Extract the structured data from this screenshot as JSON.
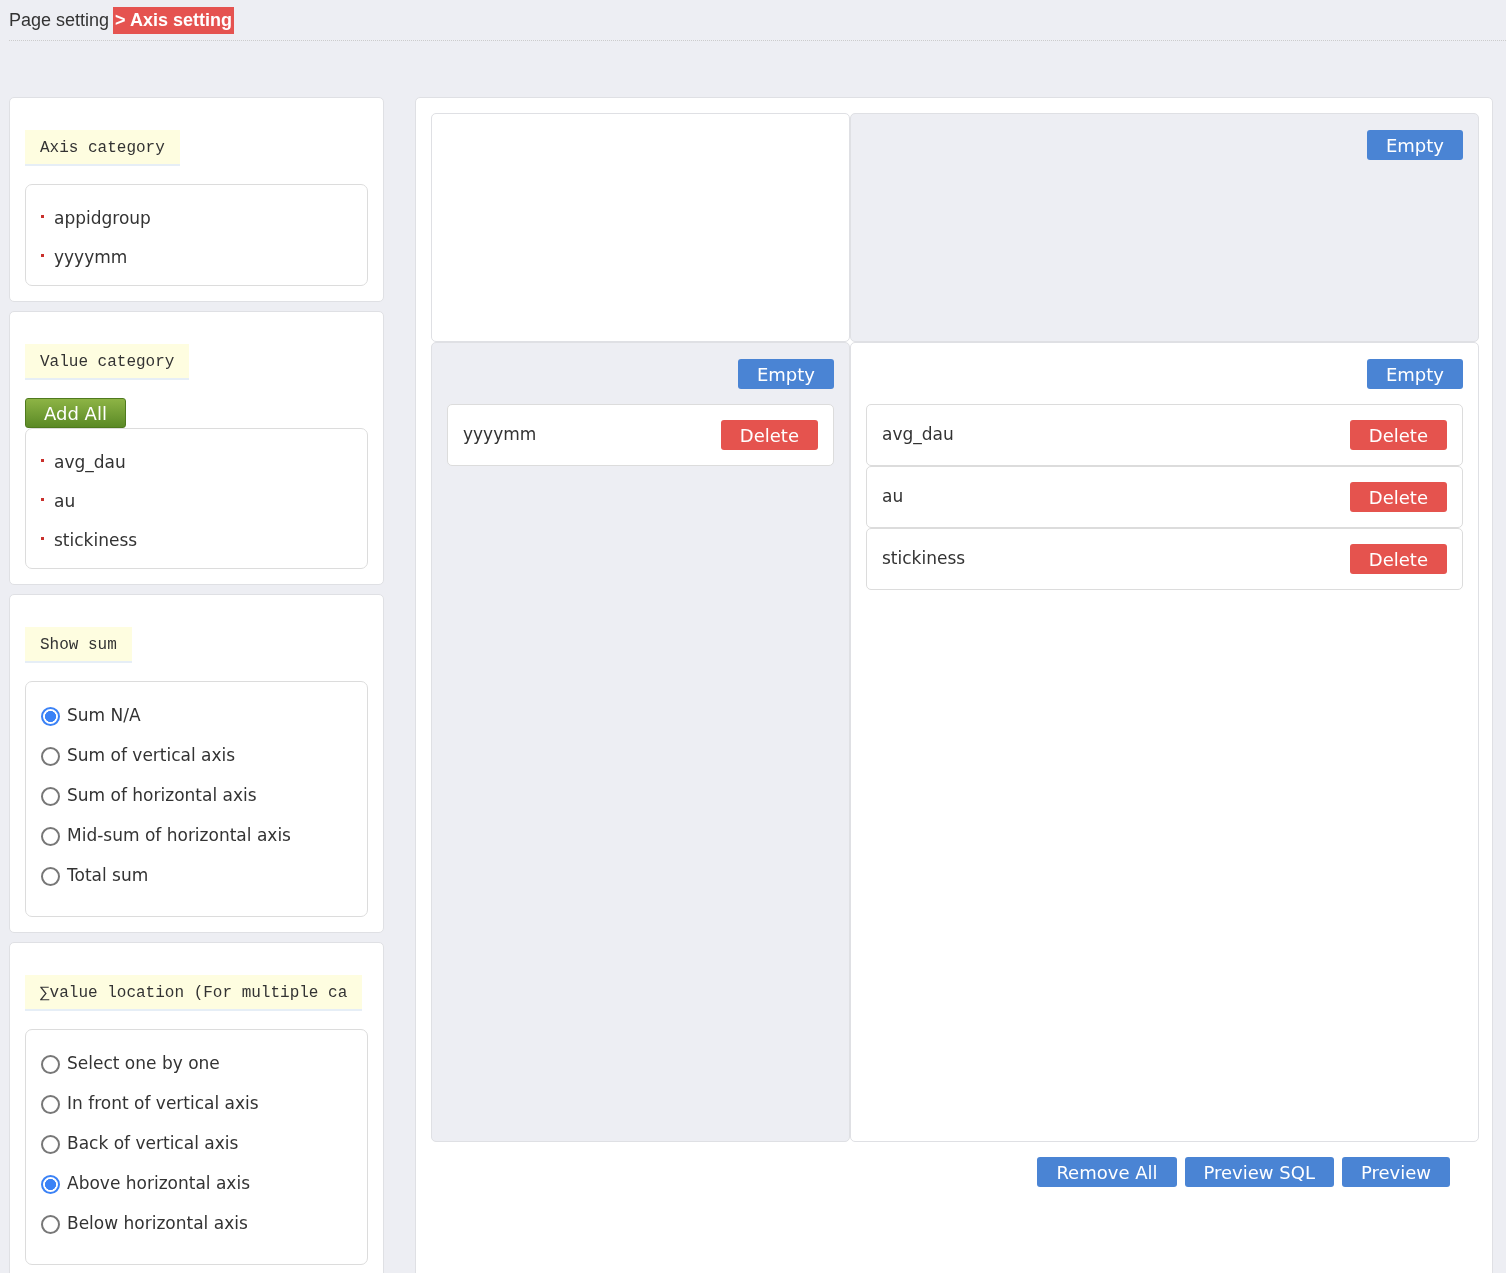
{
  "header": {
    "breadcrumb": "Page setting",
    "current": "> Axis setting"
  },
  "sections": [
    {
      "kind": "list",
      "title": "Axis category",
      "items": [
        "appidgroup",
        "yyyymm"
      ]
    },
    {
      "kind": "list",
      "title": "Value category",
      "add_button": "Add All",
      "items": [
        "avg_dau",
        "au",
        "stickiness"
      ]
    },
    {
      "kind": "radio",
      "title": "Show sum",
      "options": [
        {
          "label": "Sum N/A",
          "selected": true
        },
        {
          "label": "Sum of vertical axis",
          "selected": false
        },
        {
          "label": "Sum of horizontal axis",
          "selected": false
        },
        {
          "label": "Mid-sum of horizontal axis",
          "selected": false
        },
        {
          "label": "Total sum",
          "selected": false
        }
      ]
    },
    {
      "kind": "radio",
      "title": "∑value location (For multiple ca",
      "options": [
        {
          "label": "Select one by one",
          "selected": false
        },
        {
          "label": "In front of vertical axis",
          "selected": false
        },
        {
          "label": "Back of vertical axis",
          "selected": false
        },
        {
          "label": "Above horizontal axis",
          "selected": true
        },
        {
          "label": "Below horizontal axis",
          "selected": false
        }
      ]
    }
  ],
  "zones": [
    {
      "kind": "blank",
      "shaded": false
    },
    {
      "kind": "drop",
      "shaded": true,
      "empty_button": "Empty"
    },
    {
      "kind": "drop",
      "shaded": true,
      "empty_button": "Empty",
      "fields": [
        {
          "name": "yyyymm",
          "delete_button": "Delete"
        }
      ]
    },
    {
      "kind": "drop",
      "shaded": false,
      "empty_button": "Empty",
      "fields": [
        {
          "name": "avg_dau",
          "delete_button": "Delete"
        },
        {
          "name": "au",
          "delete_button": "Delete"
        },
        {
          "name": "stickiness",
          "delete_button": "Delete"
        }
      ]
    }
  ],
  "actions": [
    "Remove All",
    "Preview SQL",
    "Preview"
  ]
}
